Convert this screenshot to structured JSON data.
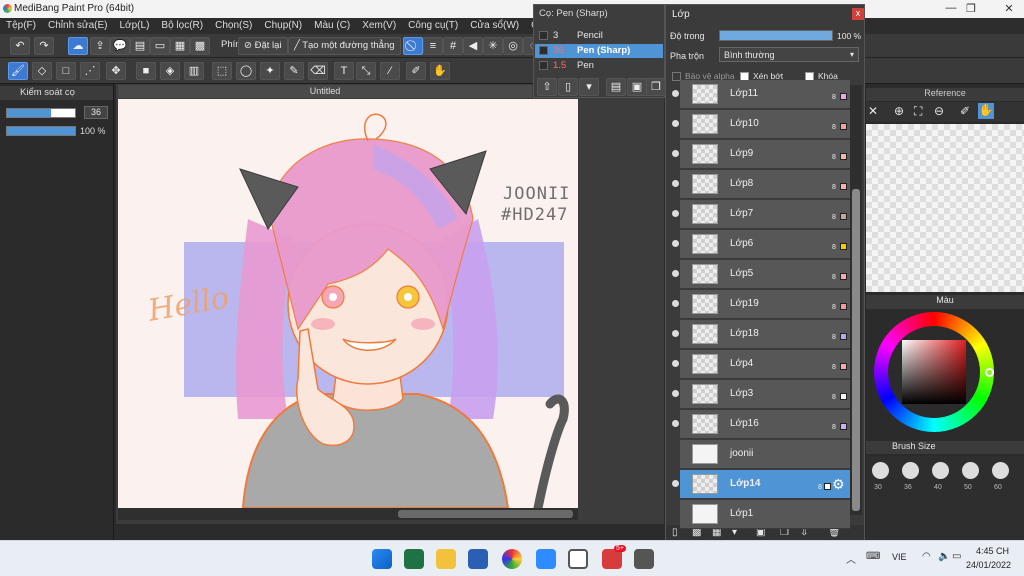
{
  "window": {
    "title": "MediBang Paint Pro (64bit)",
    "min_glyph": "—",
    "max_glyph": "❐",
    "close_glyph": "✕"
  },
  "menu": [
    "Tệp(F)",
    "Chỉnh sửa(E)",
    "Lớp(L)",
    "Bộ lọc(R)",
    "Chọn(S)",
    "Chụp(N)",
    "Màu (C)",
    "Xem(V)",
    "Công cụ(T)",
    "Cửa sổ(W)",
    "Cloud"
  ],
  "toolbar": {
    "brush_label": "Phím",
    "reset_label": "Đặt lại",
    "straight_line_label": "Tạo một đường thẳng"
  },
  "brush_control": {
    "title": "Kiểm soát cọ",
    "size_value": "36",
    "opacity_value": "100 %",
    "size_fraction": 0.65,
    "opacity_fraction": 1.0
  },
  "canvas": {
    "tab_title": "Untitled",
    "signature_line1": "JOONII",
    "signature_line2": "#HD247",
    "scribble_text": "Hello"
  },
  "brush_popup": {
    "title": "Cọ: Pen (Sharp)",
    "items": [
      {
        "size": "3",
        "name": "Pencil",
        "selected": false
      },
      {
        "size": "36",
        "name": "Pen (Sharp)",
        "selected": true
      },
      {
        "size": "1.5",
        "name": "Pen",
        "selected": false
      }
    ]
  },
  "layer_panel": {
    "title": "Lớp",
    "close_glyph": "x",
    "opacity_label": "Độ trong",
    "opacity_value": "100 %",
    "opacity_fraction": 1.0,
    "blend_label": "Pha trộn",
    "blend_value": "Bình thường",
    "protect_alpha_label": "Bảo vệ alpha",
    "clipping_label": "Xén bớt",
    "lock_label": "Khóa",
    "bit_depth": "8",
    "layers": [
      {
        "name": "Lớp11",
        "color": "#e8a9e2"
      },
      {
        "name": "Lớp10",
        "color": "#f2a3a0"
      },
      {
        "name": "Lớp9",
        "color": "#f3b7a4"
      },
      {
        "name": "Lớp8",
        "color": "#f4b3a8"
      },
      {
        "name": "Lớp7",
        "color": "#c7a59d"
      },
      {
        "name": "Lớp6",
        "color": "#f0d000"
      },
      {
        "name": "Lớp5",
        "color": "#f6aab2"
      },
      {
        "name": "Lớp19",
        "color": "#f29aa0"
      },
      {
        "name": "Lớp18",
        "color": "#b3a9ee"
      },
      {
        "name": "Lớp4",
        "color": "#f5a8b8"
      },
      {
        "name": "Lớp3",
        "color": "#f6f6f6"
      },
      {
        "name": "Lớp16",
        "color": "#c9b1f0"
      },
      {
        "name": "joonii",
        "color": ""
      },
      {
        "name": "Lớp14",
        "color": "#ffffff"
      },
      {
        "name": "Lớp1",
        "color": ""
      }
    ],
    "selected_layer": "Lớp14"
  },
  "right_panel": {
    "reference_title": "Reference",
    "color_title": "Màu",
    "brush_size_title": "Brush Size",
    "sizes": [
      "30",
      "36",
      "40",
      "50",
      "60"
    ]
  },
  "taskbar": {
    "language": "VIE",
    "time": "4:45 CH",
    "date": "24/01/2022",
    "badge": "5+",
    "zalo_label": "Zalo"
  },
  "colors": {
    "accent": "#4f95d6",
    "panel": "#3b3b3b",
    "selected_brush": "#ff6b6b"
  }
}
